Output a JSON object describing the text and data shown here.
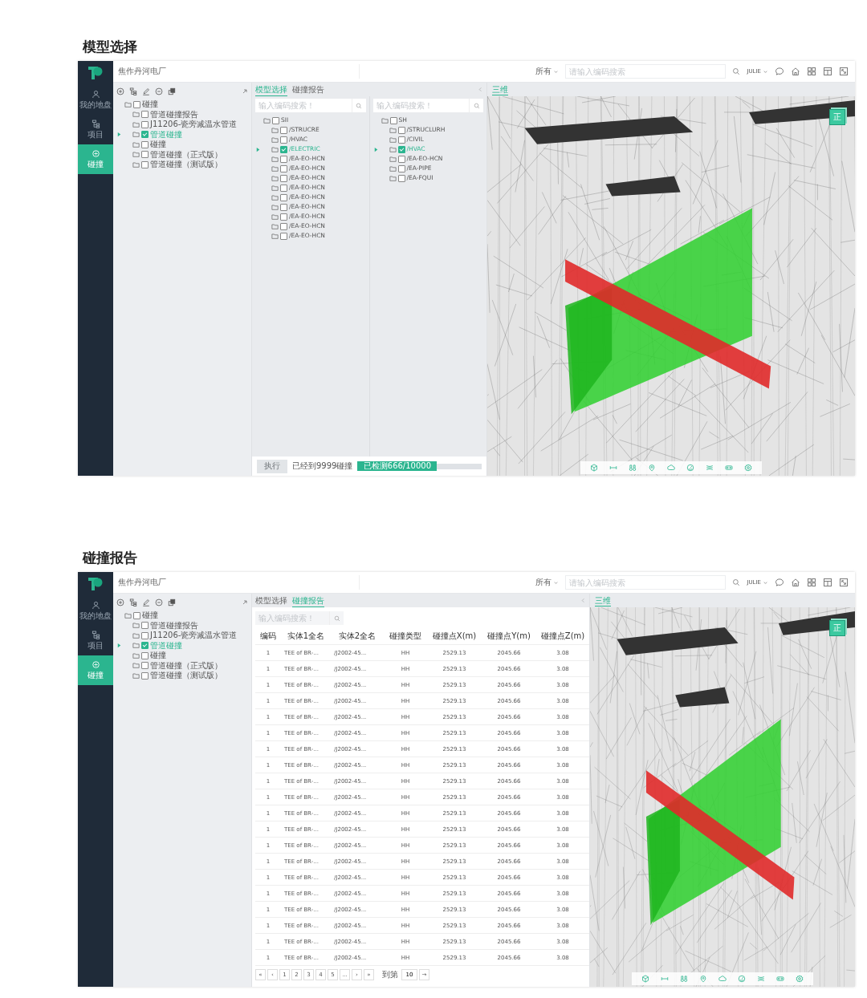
{
  "sections": [
    {
      "heading": "模型选择",
      "app": {
        "header": {
          "project": "焦作丹河电厂",
          "scope": "所有",
          "search_placeholder": "请输入编码搜索",
          "user": "JULIE"
        },
        "nav": [
          {
            "label": "我的地盘",
            "selected": false
          },
          {
            "label": "项目",
            "selected": false
          },
          {
            "label": "碰撞",
            "selected": true
          }
        ],
        "tree": [
          {
            "label": "碰撞",
            "checked": false,
            "selected": false,
            "children": [
              {
                "label": "管道碰撞报告",
                "checked": false,
                "selected": false
              },
              {
                "label": "J11206-瓷旁减温水管道",
                "checked": false,
                "selected": false
              },
              {
                "label": "管道碰撞",
                "checked": true,
                "selected": true
              },
              {
                "label": "碰撞",
                "checked": false,
                "selected": false
              },
              {
                "label": "管道碰撞（正式版）",
                "checked": false,
                "selected": false
              },
              {
                "label": "管道碰撞（测试版）",
                "checked": false,
                "selected": false
              }
            ]
          }
        ],
        "tabs": [
          {
            "label": "模型选择",
            "selected": true
          },
          {
            "label": "碰撞报告",
            "selected": false
          }
        ],
        "panel": {
          "kind": "models",
          "columns": [
            {
              "search_placeholder": "输入编码搜索！",
              "tree": [
                {
                  "label": "SII",
                  "checked": false,
                  "selected": false,
                  "children": [
                    {
                      "label": "/STRUCRE",
                      "checked": false,
                      "selected": false
                    },
                    {
                      "label": "/HVAC",
                      "checked": false,
                      "selected": false
                    },
                    {
                      "label": "/ELECTRIC",
                      "checked": true,
                      "selected": true
                    },
                    {
                      "label": "/EA-EO-HCN",
                      "checked": false,
                      "selected": false
                    },
                    {
                      "label": "/EA-EO-HCN",
                      "checked": false,
                      "selected": false
                    },
                    {
                      "label": "/EA-EO-HCN",
                      "checked": false,
                      "selected": false
                    },
                    {
                      "label": "/EA-EO-HCN",
                      "checked": false,
                      "selected": false
                    },
                    {
                      "label": "/EA-EO-HCN",
                      "checked": false,
                      "selected": false
                    },
                    {
                      "label": "/EA-EO-HCN",
                      "checked": false,
                      "selected": false
                    },
                    {
                      "label": "/EA-EO-HCN",
                      "checked": false,
                      "selected": false
                    },
                    {
                      "label": "/EA-EO-HCN",
                      "checked": false,
                      "selected": false
                    },
                    {
                      "label": "/EA-EO-HCN",
                      "checked": false,
                      "selected": false
                    }
                  ]
                }
              ]
            },
            {
              "search_placeholder": "输入编码搜索！",
              "tree": [
                {
                  "label": "SH",
                  "checked": false,
                  "selected": false,
                  "children": [
                    {
                      "label": "/STRUCLURH",
                      "checked": false,
                      "selected": false
                    },
                    {
                      "label": "/CIVIL",
                      "checked": false,
                      "selected": false
                    },
                    {
                      "label": "/HVAC",
                      "checked": true,
                      "selected": true
                    },
                    {
                      "label": "/EA-EO-HCN",
                      "checked": false,
                      "selected": false
                    },
                    {
                      "label": "/EA-PIPE",
                      "checked": false,
                      "selected": false
                    },
                    {
                      "label": "/EA-FQUI",
                      "checked": false,
                      "selected": false
                    }
                  ]
                }
              ]
            }
          ],
          "run_button": {
            "label": "执行",
            "disabled": true
          },
          "status": "已经到9999碰撞",
          "progress": {
            "label": "已检测666/10000",
            "level": 0.64
          }
        },
        "view": {
          "tab": "三维",
          "cube_label": "正"
        }
      }
    },
    {
      "heading": "碰撞报告",
      "app": {
        "header": {
          "project": "焦作丹河电厂",
          "scope": "所有",
          "search_placeholder": "请输入编码搜索",
          "user": "JULIE"
        },
        "nav": [
          {
            "label": "我的地盘",
            "selected": false
          },
          {
            "label": "项目",
            "selected": false
          },
          {
            "label": "碰撞",
            "selected": true
          }
        ],
        "tree": [
          {
            "label": "碰撞",
            "checked": false,
            "selected": false,
            "children": [
              {
                "label": "管道碰撞报告",
                "checked": false,
                "selected": false
              },
              {
                "label": "J11206-瓷旁减温水管道",
                "checked": false,
                "selected": false
              },
              {
                "label": "管道碰撞",
                "checked": true,
                "selected": true
              },
              {
                "label": "碰撞",
                "checked": false,
                "selected": false
              },
              {
                "label": "管道碰撞（正式版）",
                "checked": false,
                "selected": false
              },
              {
                "label": "管道碰撞（测试版）",
                "checked": false,
                "selected": false
              }
            ]
          }
        ],
        "tabs": [
          {
            "label": "模型选择",
            "selected": false
          },
          {
            "label": "碰撞报告",
            "selected": true
          }
        ],
        "panel": {
          "kind": "report",
          "search_placeholder": "输入编码搜索！",
          "columns": [
            "编码",
            "实体1全名",
            "实体2全名",
            "碰撞类型",
            "碰撞点X(m)",
            "碰撞点Y(m)",
            "碰撞点Z(m)"
          ],
          "rows": [
            [
              "1",
              "TEE of BR-...",
              "/J2002-45...",
              "HH",
              "2529.13",
              "2045.66",
              "3.08"
            ],
            [
              "1",
              "TEE of BR-...",
              "/J2002-45...",
              "HH",
              "2529.13",
              "2045.66",
              "3.08"
            ],
            [
              "1",
              "TEE of BR-...",
              "/J2002-45...",
              "HH",
              "2529.13",
              "2045.66",
              "3.08"
            ],
            [
              "1",
              "TEE of BR-...",
              "/J2002-45...",
              "HH",
              "2529.13",
              "2045.66",
              "3.08"
            ],
            [
              "1",
              "TEE of BR-...",
              "/J2002-45...",
              "HH",
              "2529.13",
              "2045.66",
              "3.08"
            ],
            [
              "1",
              "TEE of BR-...",
              "/J2002-45...",
              "HH",
              "2529.13",
              "2045.66",
              "3.08"
            ],
            [
              "1",
              "TEE of BR-...",
              "/J2002-45...",
              "HH",
              "2529.13",
              "2045.66",
              "3.08"
            ],
            [
              "1",
              "TEE of BR-...",
              "/J2002-45...",
              "HH",
              "2529.13",
              "2045.66",
              "3.08"
            ],
            [
              "1",
              "TEE of BR-...",
              "/J2002-45...",
              "HH",
              "2529.13",
              "2045.66",
              "3.08"
            ],
            [
              "1",
              "TEE of BR-...",
              "/J2002-45...",
              "HH",
              "2529.13",
              "2045.66",
              "3.08"
            ],
            [
              "1",
              "TEE of BR-...",
              "/J2002-45...",
              "HH",
              "2529.13",
              "2045.66",
              "3.08"
            ],
            [
              "1",
              "TEE of BR-...",
              "/J2002-45...",
              "HH",
              "2529.13",
              "2045.66",
              "3.08"
            ],
            [
              "1",
              "TEE of BR-...",
              "/J2002-45...",
              "HH",
              "2529.13",
              "2045.66",
              "3.08"
            ],
            [
              "1",
              "TEE of BR-...",
              "/J2002-45...",
              "HH",
              "2529.13",
              "2045.66",
              "3.08"
            ],
            [
              "1",
              "TEE of BR-...",
              "/J2002-45...",
              "HH",
              "2529.13",
              "2045.66",
              "3.08"
            ],
            [
              "1",
              "TEE of BR-...",
              "/J2002-45...",
              "HH",
              "2529.13",
              "2045.66",
              "3.08"
            ],
            [
              "1",
              "TEE of BR-...",
              "/J2002-45...",
              "HH",
              "2529.13",
              "2045.66",
              "3.08"
            ],
            [
              "1",
              "TEE of BR-...",
              "/J2002-45...",
              "HH",
              "2529.13",
              "2045.66",
              "3.08"
            ],
            [
              "1",
              "TEE of BR-...",
              "/J2002-45...",
              "HH",
              "2529.13",
              "2045.66",
              "3.08"
            ],
            [
              "1",
              "TEE of BR-...",
              "/J2002-45...",
              "HH",
              "2529.13",
              "2045.66",
              "3.08"
            ]
          ],
          "pagination": {
            "pages": [
              "«",
              "‹",
              "1",
              "2",
              "3",
              "4",
              "5",
              "...",
              "›",
              "»"
            ],
            "goto_label": "到第",
            "goto_value": "10",
            "go_button": "→"
          }
        },
        "view": {
          "tab": "三维",
          "cube_label": "正"
        }
      }
    }
  ]
}
